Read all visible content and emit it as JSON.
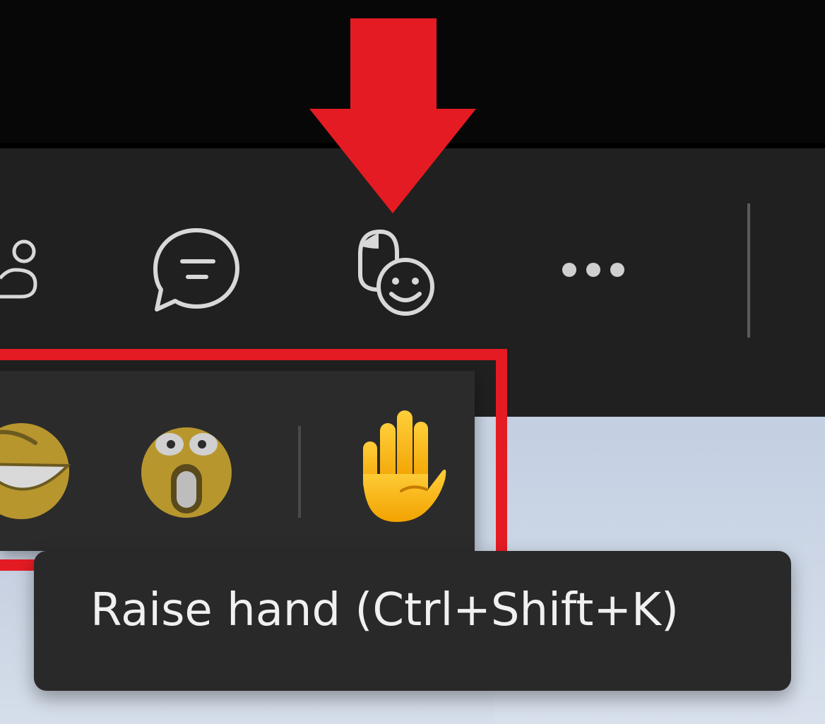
{
  "toolbar": {
    "buttons": [
      {
        "name": "people",
        "icon": "people-icon"
      },
      {
        "name": "chat",
        "icon": "chat-icon"
      },
      {
        "name": "react",
        "icon": "react-icon"
      },
      {
        "name": "more",
        "icon": "more-options-icon"
      }
    ]
  },
  "reactions": {
    "items": [
      {
        "name": "laugh",
        "icon": "laughing-emoji-icon"
      },
      {
        "name": "surprised",
        "icon": "surprised-emoji-icon"
      },
      {
        "name": "raise-hand",
        "icon": "raised-hand-icon"
      }
    ]
  },
  "tooltip": {
    "text": "Raise hand (Ctrl+Shift+K)"
  },
  "annotations": {
    "arrow_color": "#e51b23",
    "highlight_color": "#e51b23"
  },
  "colors": {
    "toolbar_bg": "#202020",
    "panel_bg": "#2b2b2b",
    "tooltip_bg": "#292929",
    "icon_stroke": "#d8d8d8"
  }
}
